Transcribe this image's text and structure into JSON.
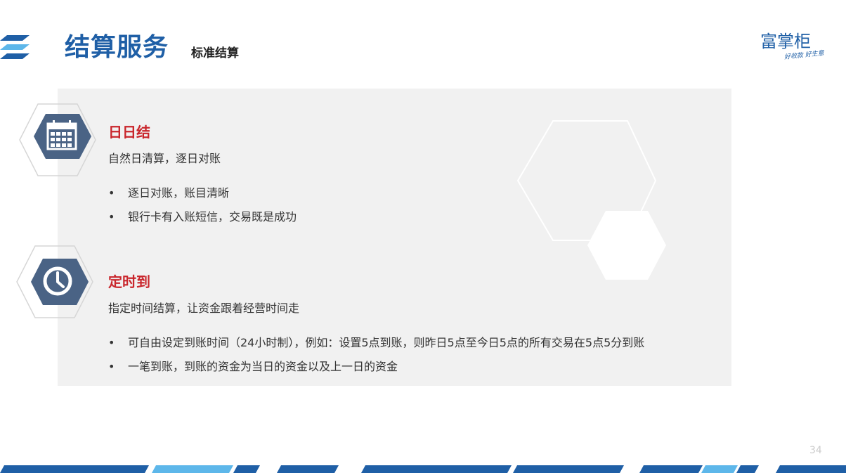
{
  "header": {
    "title": "结算服务",
    "subtitle": "标准结算"
  },
  "logo": {
    "name": "富掌柜",
    "tagline": "好收款 好生意"
  },
  "sections": [
    {
      "icon": "calendar-icon",
      "title": "日日结",
      "subtitle": "自然日清算，逐日对账",
      "bullets": [
        "逐日对账，账目清晰",
        "银行卡有入账短信，交易既是成功"
      ]
    },
    {
      "icon": "clock-icon",
      "title": "定时到",
      "subtitle": "指定时间结算，让资金跟着经营时间走",
      "bullets": [
        "可自由设定到账时间（24小时制），例如：设置5点到账，则昨日5点至今日5点的所有交易在5点5分到账",
        "一笔到账，到账的资金为当日的资金以及上一日的资金"
      ]
    }
  ],
  "bullet_symbol": "•",
  "page_number": "34",
  "colors": {
    "brand_blue": "#1f5fa6",
    "accent_red": "#c9262c",
    "icon_slate": "#4a6385",
    "light_blue": "#5db7ea",
    "panel_gray": "#f1f1f1"
  }
}
